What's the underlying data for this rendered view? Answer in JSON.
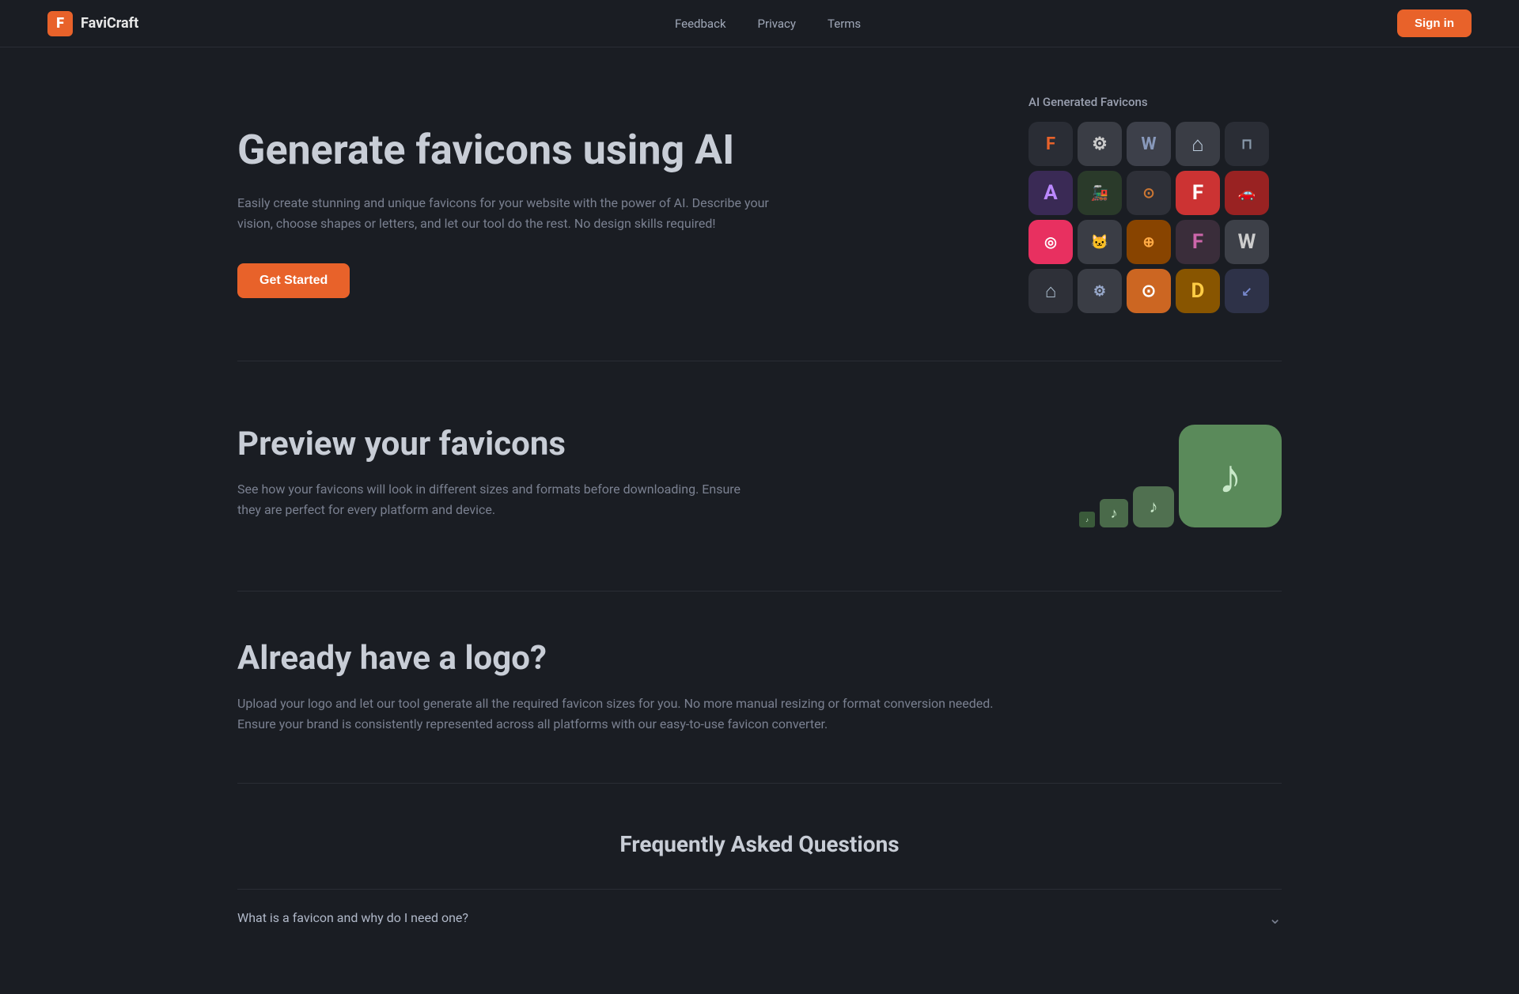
{
  "nav": {
    "logo_letter": "F",
    "logo_name": "FaviCraft",
    "links": [
      {
        "label": "Feedback",
        "href": "#"
      },
      {
        "label": "Privacy",
        "href": "#"
      },
      {
        "label": "Terms",
        "href": "#"
      }
    ],
    "signin_label": "Sign in"
  },
  "hero": {
    "title": "Generate favicons using AI",
    "description": "Easily create stunning and unique favicons for your website with the power of AI. Describe your vision, choose shapes or letters, and let our tool do the rest. No design skills required!",
    "cta_label": "Get Started",
    "favicons_panel_title": "AI Generated Favicons",
    "favicons": [
      {
        "symbol": "F",
        "theme": "fc-dark"
      },
      {
        "symbol": "⚙",
        "theme": "fc-gray"
      },
      {
        "symbol": "W",
        "theme": "fc-blue-gray"
      },
      {
        "symbol": "⌂",
        "theme": "fc-dark2"
      },
      {
        "symbol": "⊓",
        "theme": "fc-dark3"
      },
      {
        "symbol": "A",
        "theme": "fc-purple"
      },
      {
        "symbol": "🚂",
        "theme": "fc-teal"
      },
      {
        "symbol": "⊙",
        "theme": "fc-orange-dark"
      },
      {
        "symbol": "F",
        "theme": "fc-red"
      },
      {
        "symbol": "🚗",
        "theme": "fc-red2"
      },
      {
        "symbol": "◎",
        "theme": "fc-colorful"
      },
      {
        "symbol": "🐱",
        "theme": "fc-dark4"
      },
      {
        "symbol": "⊕",
        "theme": "fc-orange2"
      },
      {
        "symbol": "F",
        "theme": "fc-orange3"
      },
      {
        "symbol": "W",
        "theme": "fc-green"
      },
      {
        "symbol": "⌂",
        "theme": "fc-gray2"
      },
      {
        "symbol": "⚙",
        "theme": "fc-gear"
      },
      {
        "symbol": "⊙",
        "theme": "fc-orange4"
      },
      {
        "symbol": "D",
        "theme": "fc-dark5"
      },
      {
        "symbol": "↓",
        "theme": "fc-blue2"
      }
    ]
  },
  "preview": {
    "title": "Preview your favicons",
    "description": "See how your favicons will look in different sizes and formats before downloading. Ensure they are perfect for every platform and device."
  },
  "logo_section": {
    "title": "Already have a logo?",
    "description": "Upload your logo and let our tool generate all the required favicon sizes for you. No more manual resizing or format conversion needed. Ensure your brand is consistently represented across all platforms with our easy-to-use favicon converter."
  },
  "faq": {
    "title": "Frequently Asked Questions",
    "items": [
      {
        "question": "What is a favicon and why do I need one?",
        "open": false
      }
    ]
  }
}
